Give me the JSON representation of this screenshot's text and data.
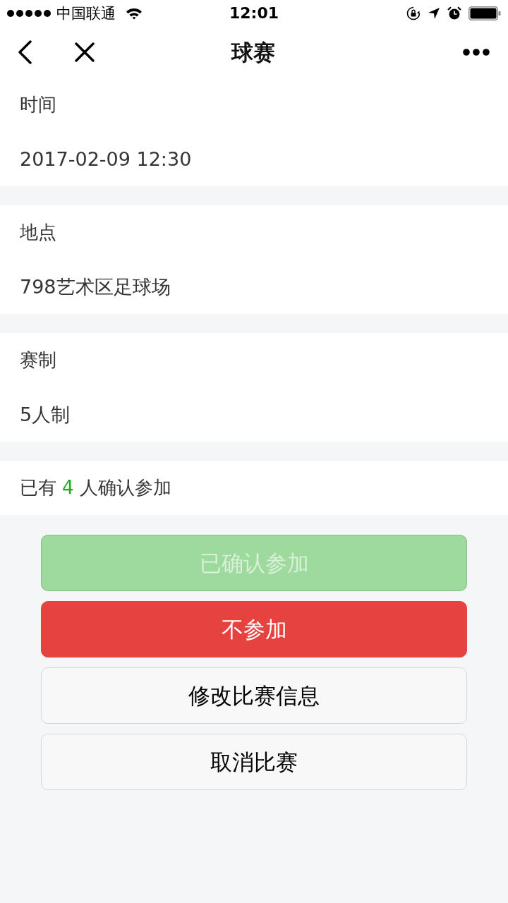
{
  "status_bar": {
    "carrier": "中国联通",
    "time": "12:01"
  },
  "nav": {
    "title": "球赛"
  },
  "fields": [
    {
      "label": "时间",
      "value": "2017-02-09 12:30"
    },
    {
      "label": "地点",
      "value": "798艺术区足球场"
    },
    {
      "label": "赛制",
      "value": "5人制"
    }
  ],
  "summary": {
    "prefix": "已有",
    "count": "4",
    "suffix": "人确认参加"
  },
  "buttons": [
    {
      "label": "已确认参加",
      "kind": "primary",
      "disabled": true
    },
    {
      "label": "不参加",
      "kind": "warn",
      "disabled": false
    },
    {
      "label": "修改比赛信息",
      "kind": "default",
      "disabled": false
    },
    {
      "label": "取消比赛",
      "kind": "default",
      "disabled": false
    }
  ]
}
